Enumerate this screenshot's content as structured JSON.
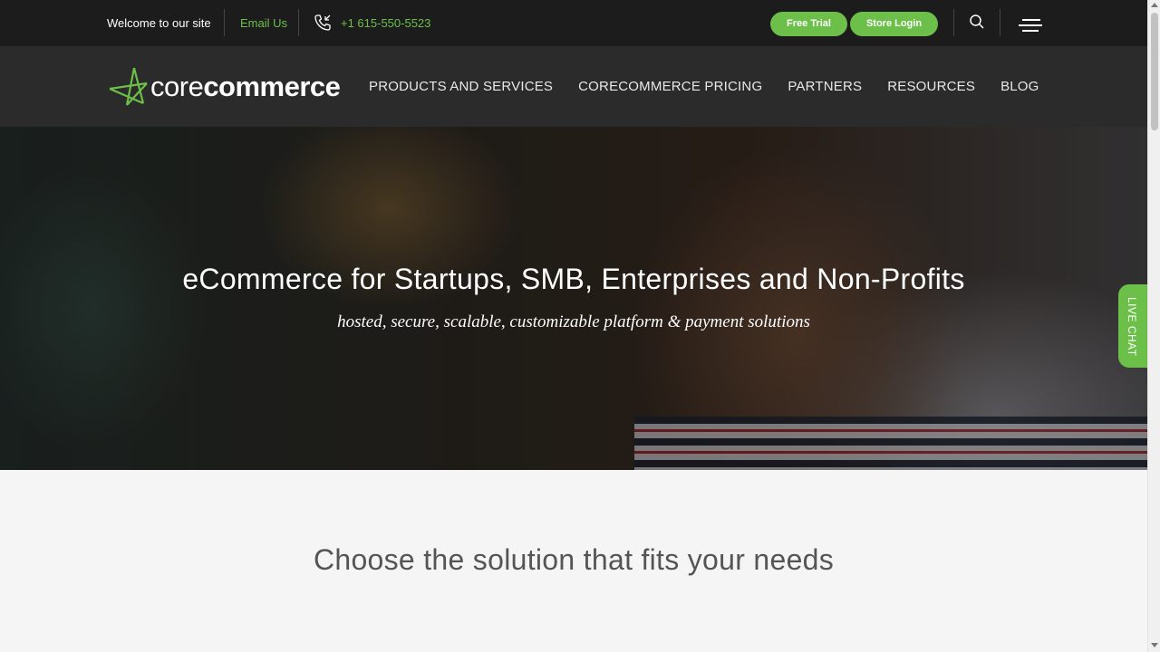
{
  "topbar": {
    "welcome": "Welcome to our site",
    "email_label": "Email Us",
    "phone": "+1 615-550-5523",
    "free_trial": "Free Trial",
    "store_login": "Store Login",
    "icons": [
      "phone-icon",
      "search-icon",
      "menu-icon"
    ]
  },
  "header": {
    "logo": {
      "light": "core",
      "bold": "commerce"
    },
    "nav": [
      {
        "label": "PRODUCTS AND SERVICES"
      },
      {
        "label": "CORECOMMERCE PRICING"
      },
      {
        "label": "PARTNERS"
      },
      {
        "label": "RESOURCES"
      },
      {
        "label": "BLOG"
      }
    ]
  },
  "hero": {
    "title": "eCommerce for Startups, SMB, Enterprises and Non-Profits",
    "tagline": "hosted, secure, scalable, customizable platform & payment solutions"
  },
  "livechat": {
    "label": "LIVE CHAT"
  },
  "section": {
    "title": "Choose the solution that fits your needs"
  },
  "colors": {
    "accent": "#6cc04a",
    "topbar": "#1c1c1c",
    "header": "#2b2b2b"
  }
}
